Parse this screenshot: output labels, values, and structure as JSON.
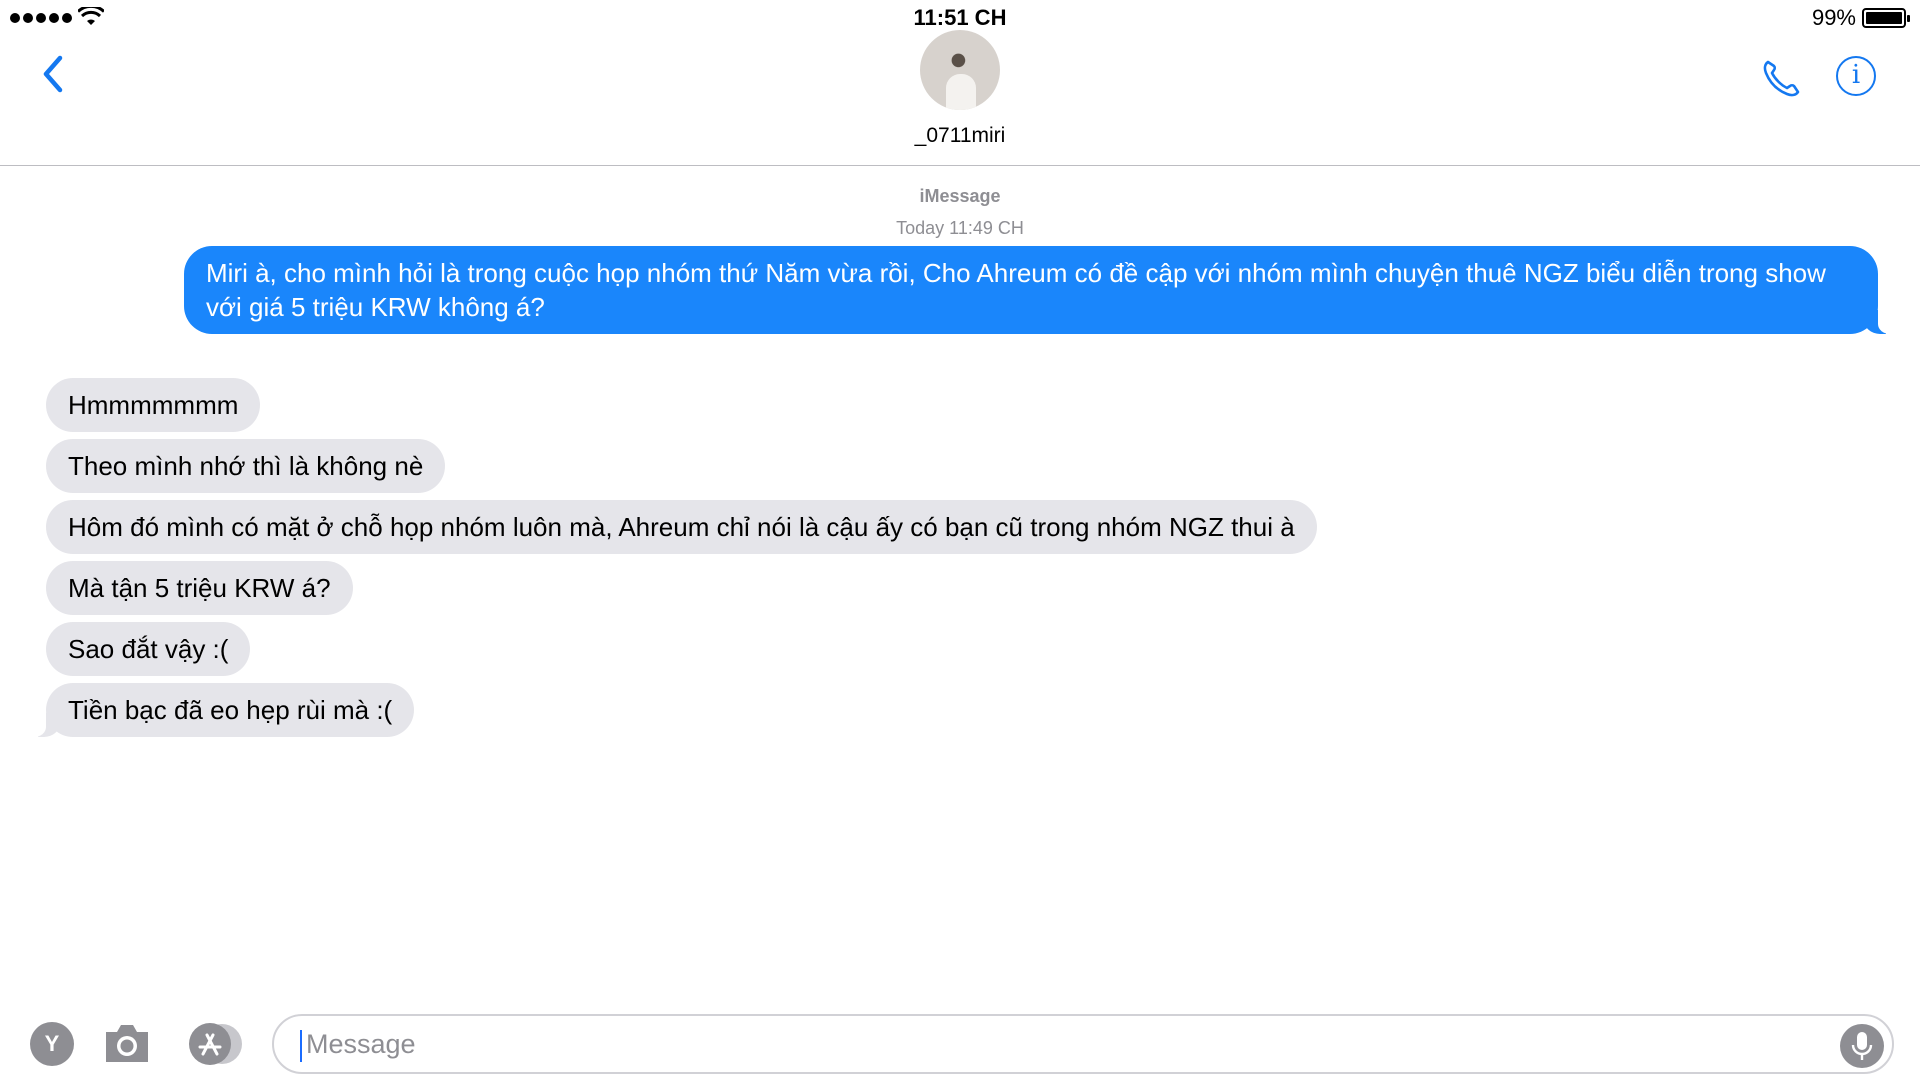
{
  "status_bar": {
    "time": "11:51 CH",
    "battery_percent": "99%",
    "signal_bars": 5
  },
  "header": {
    "contact_name": "_0711miri",
    "back_icon": "chevron-left-icon",
    "call_icon": "phone-icon",
    "info_icon": "info-icon",
    "info_glyph": "i"
  },
  "thread": {
    "service_label": "iMessage",
    "timestamp": "Today 11:49 CH",
    "sent": [
      {
        "text": "Miri à, cho mình hỏi là trong cuộc họp nhóm thứ Năm vừa rồi, Cho Ahreum có đề cập với nhóm mình chuyện thuê NGZ biểu diễn trong show với giá 5 triệu KRW không á?"
      }
    ],
    "received": [
      {
        "text": "Hmmmmmmm"
      },
      {
        "text": "Theo mình nhớ thì là không nè"
      },
      {
        "text": "Hôm đó mình có mặt ở chỗ họp nhóm luôn mà, Ahreum chỉ nói là cậu ấy có bạn cũ trong nhóm NGZ thui à"
      },
      {
        "text": "Mà tận 5 triệu KRW á?"
      },
      {
        "text": "Sao đắt vậy :("
      },
      {
        "text": "Tiền bạc đã eo hẹp rùi mà :("
      }
    ]
  },
  "compose": {
    "digital_touch_label": "Y",
    "camera_icon": "camera-icon",
    "app_store_icon": "app-store-icon",
    "placeholder": "Message",
    "mic_icon": "microphone-icon"
  },
  "colors": {
    "accent": "#1478f0",
    "sent_bubble": "#1a86fb",
    "received_bubble": "#e5e5ea",
    "secondary_text": "#8e8e93"
  }
}
